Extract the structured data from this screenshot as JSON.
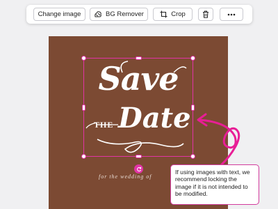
{
  "toolbar": {
    "change_image_label": "Change image",
    "bg_remover_label": "BG Remover",
    "crop_label": "Crop",
    "icons": [
      "bg-remover-icon",
      "crop-icon",
      "trash-icon",
      "more-icon"
    ]
  },
  "artwork": {
    "line1": "Save",
    "line2_small": "THE",
    "line2": "Date",
    "footer": "for the wedding of"
  },
  "tooltip": {
    "text": "If using images with text, we recommend locking the image if it is not intended to be modified."
  },
  "colors": {
    "accent": "#e234a6",
    "canvas_bg": "#7c4a33",
    "toolbar_bg": "#ffffff"
  }
}
